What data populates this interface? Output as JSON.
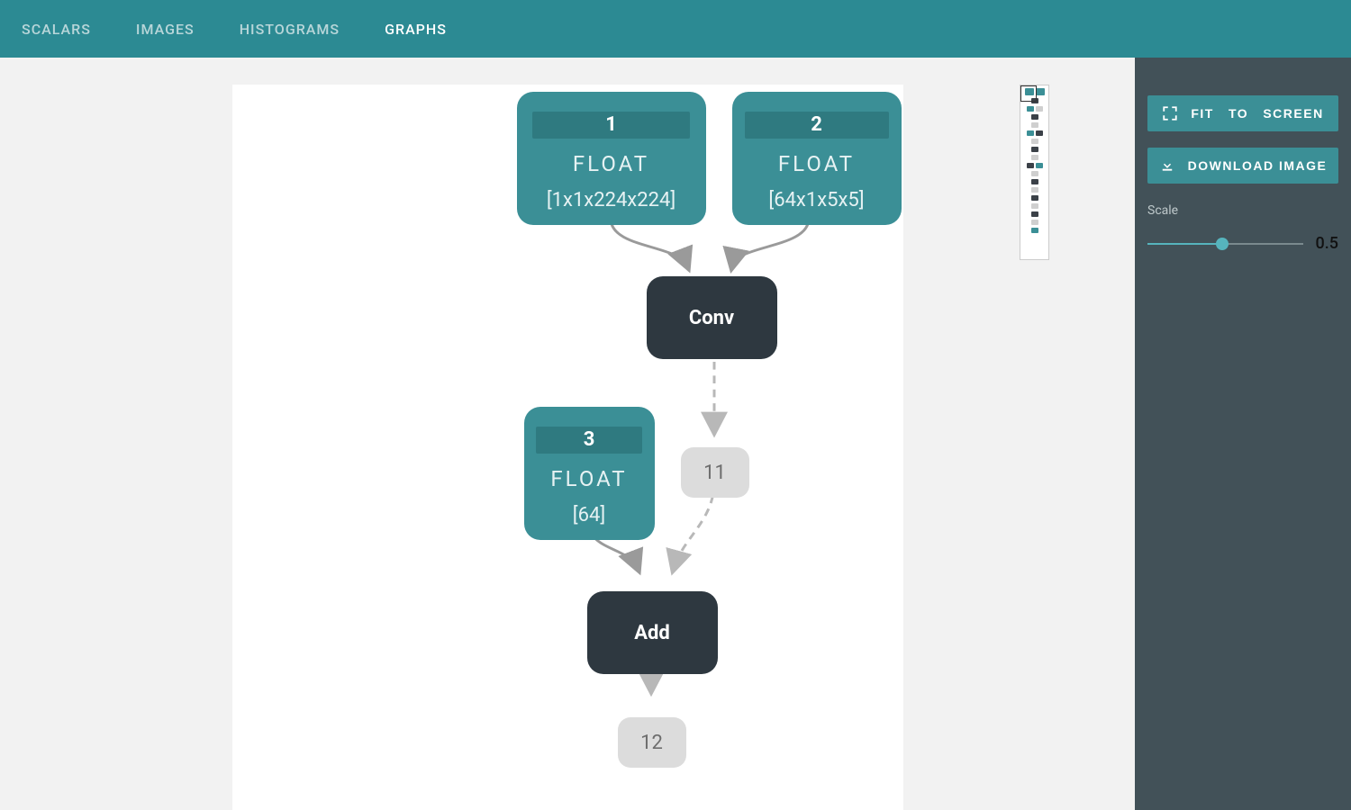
{
  "tabs": {
    "scalars": "SCALARS",
    "images": "IMAGES",
    "histograms": "HISTOGRAMS",
    "graphs": "GRAPHS",
    "active": "graphs"
  },
  "graph": {
    "inputs": [
      {
        "id": "1",
        "dtype": "FLOAT",
        "shape": "[1x1x224x224]"
      },
      {
        "id": "2",
        "dtype": "FLOAT",
        "shape": "[64x1x5x5]"
      },
      {
        "id": "3",
        "dtype": "FLOAT",
        "shape": "[64]"
      }
    ],
    "ops": [
      {
        "name": "Conv"
      },
      {
        "name": "Add"
      }
    ],
    "intermediates": [
      {
        "id": "11"
      },
      {
        "id": "12"
      }
    ]
  },
  "sidebar": {
    "fit_label": "FIT   TO   SCREEN",
    "download_label": "DOWNLOAD IMAGE",
    "scale_label": "Scale",
    "scale_value": "0.5",
    "scale_fraction": 0.48
  }
}
